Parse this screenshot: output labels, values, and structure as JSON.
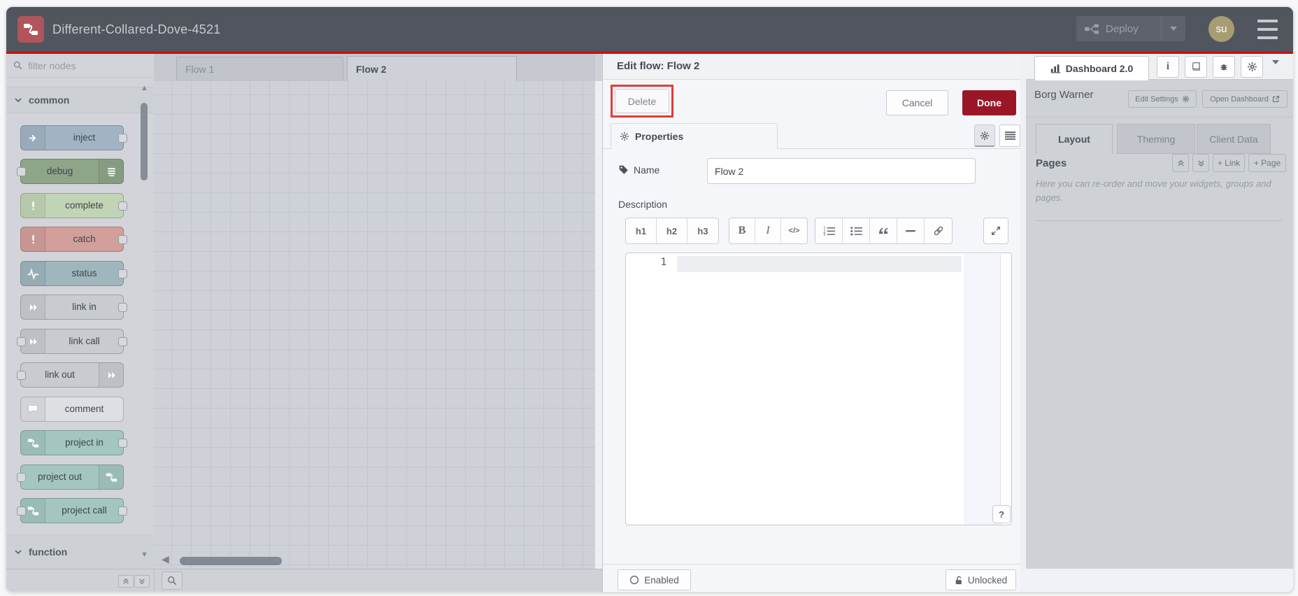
{
  "colors": {
    "header_bg": "#51555e",
    "accent_line_red": "#c8100f",
    "brand_red": "#b0555b",
    "avatar_olive": "#a89d72",
    "done_red": "#9a1626",
    "annotation_red": "#e23c3a",
    "canvas_bg": "#ced1d7",
    "sidebar_bg": "#ced1d6",
    "tray_bg": "#f5f6fa"
  },
  "header": {
    "title": "Different-Collared-Dove-4521",
    "deploy_label": "Deploy",
    "avatar_initials": "su"
  },
  "palette": {
    "filter_placeholder": "filter nodes",
    "categories": {
      "common": "common",
      "function": "function"
    },
    "nodes": [
      {
        "label": "inject",
        "color": "#a2b4c4"
      },
      {
        "label": "debug",
        "color": "#8ea588"
      },
      {
        "label": "complete",
        "color": "#c1d4b5"
      },
      {
        "label": "catch",
        "color": "#d29f9b"
      },
      {
        "label": "status",
        "color": "#9fb6bf"
      },
      {
        "label": "link in",
        "color": "#c8cbd0"
      },
      {
        "label": "link call",
        "color": "#c8cbd0"
      },
      {
        "label": "link out",
        "color": "#c8cbd0"
      },
      {
        "label": "comment",
        "color": "#dddfe3"
      },
      {
        "label": "project in",
        "color": "#a3c6c0"
      },
      {
        "label": "project out",
        "color": "#a3c6c0"
      },
      {
        "label": "project call",
        "color": "#a3c6c0"
      }
    ]
  },
  "workspace": {
    "tabs": [
      {
        "label": "Flow 1"
      },
      {
        "label": "Flow 2"
      }
    ]
  },
  "tray": {
    "title": "Edit flow: Flow 2",
    "delete_label": "Delete",
    "cancel_label": "Cancel",
    "done_label": "Done",
    "properties_tab": "Properties",
    "name_label": "Name",
    "name_value": "Flow 2",
    "description_label": "Description",
    "toolbar": {
      "h1": "h1",
      "h2": "h2",
      "h3": "h3",
      "bold": "B",
      "italic": "I",
      "code": "</>"
    },
    "editor": {
      "line_number": "1",
      "help_button": "?"
    },
    "enabled_label": "Enabled",
    "unlocked_label": "Unlocked"
  },
  "sidebar": {
    "active_tab_label": "Dashboard 2.0",
    "project_name": "Borg Warner",
    "edit_settings_label": "Edit Settings",
    "open_dashboard_label": "Open Dashboard",
    "tabs": [
      {
        "label": "Layout"
      },
      {
        "label": "Theming"
      },
      {
        "label": "Client Data"
      }
    ],
    "pages_heading": "Pages",
    "link_button_label": "+ Link",
    "page_button_label": "+ Page",
    "help_text": "Here you can re-order and move your widgets, groups and pages."
  },
  "icons": {
    "node_red_logo": "svg-two-nodes-wire",
    "deploy": "svg-node-graph",
    "hamburger": "three-bars",
    "magnifier": "svg-circle-handle",
    "gear": "svg-gear",
    "info": "i",
    "book": "svg-book",
    "bug": "svg-bug",
    "bar_chart": "svg-bars",
    "caret_down": "css-triangle",
    "triangle_up": "▲",
    "triangle_down": "▼",
    "scroll_left_arrow": "◀",
    "double_chevron_up": "svg",
    "double_chevron_down": "svg",
    "external_link": "svg",
    "unlock": "svg-padlock-open",
    "radio_circle": "svg-circle",
    "tag": "svg-tag",
    "quote": "svg-double-quote",
    "link_chain": "svg-chain",
    "expand": "svg-diagonal-arrows"
  }
}
